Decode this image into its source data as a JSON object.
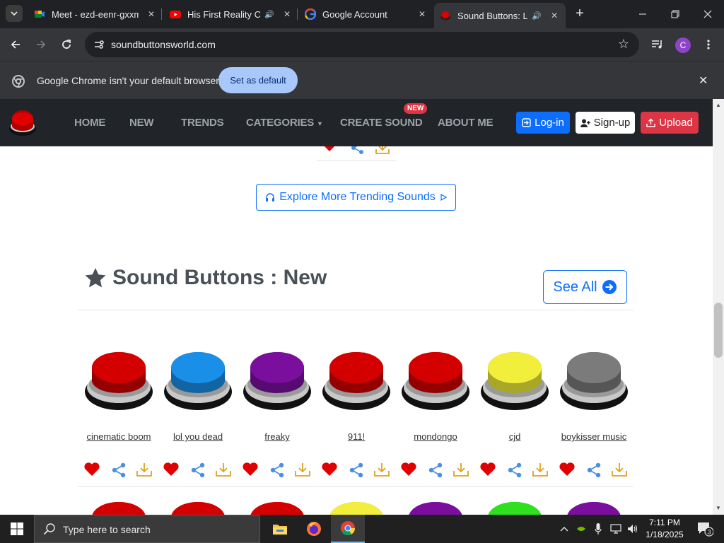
{
  "browser": {
    "tabs": [
      {
        "title": "Meet - ezd-eenr-gxxm",
        "favicon": "google-meet-icon",
        "audio": false,
        "active": false
      },
      {
        "title": "His First Reality Check",
        "favicon": "youtube-icon",
        "audio": true,
        "active": false
      },
      {
        "title": "Google Account",
        "favicon": "google-icon",
        "audio": false,
        "active": false
      },
      {
        "title": "Sound Buttons: Largest",
        "favicon": "red-button-icon",
        "audio": true,
        "active": true
      }
    ],
    "url": "soundbuttonsworld.com",
    "avatar_letter": "C",
    "infobar": {
      "message": "Google Chrome isn't your default browser",
      "button": "Set as default"
    }
  },
  "site": {
    "nav": {
      "home": "HOME",
      "new": "NEW",
      "trends": "TRENDS",
      "categories": "CATEGORIES",
      "create": "CREATE SOUND",
      "create_badge": "NEW",
      "about": "ABOUT ME",
      "login": "Log-in",
      "signup": "Sign-up",
      "upload": "Upload"
    },
    "explore_button": "Explore More Trending Sounds",
    "section_title": "Sound Buttons : New",
    "see_all": "See All",
    "sounds": [
      {
        "name": "cinematic boom",
        "color": "#d40000"
      },
      {
        "name": "lol you dead",
        "color": "#1a8fe8"
      },
      {
        "name": "freaky",
        "color": "#7a0f9e"
      },
      {
        "name": "911!",
        "color": "#d40000"
      },
      {
        "name": "mondongo",
        "color": "#d40000"
      },
      {
        "name": "cjd",
        "color": "#f2ee3c"
      },
      {
        "name": "boykisser music",
        "color": "#7b7b7b"
      }
    ],
    "next_row_colors": [
      "#d40000",
      "#d40000",
      "#d40000",
      "#f2ee3c",
      "#7a0f9e",
      "#2fe01e",
      "#7a0f9e"
    ]
  },
  "taskbar": {
    "search_placeholder": "Type here to search",
    "time": "7:11 PM",
    "date": "1/18/2025",
    "notification_count": "3"
  }
}
